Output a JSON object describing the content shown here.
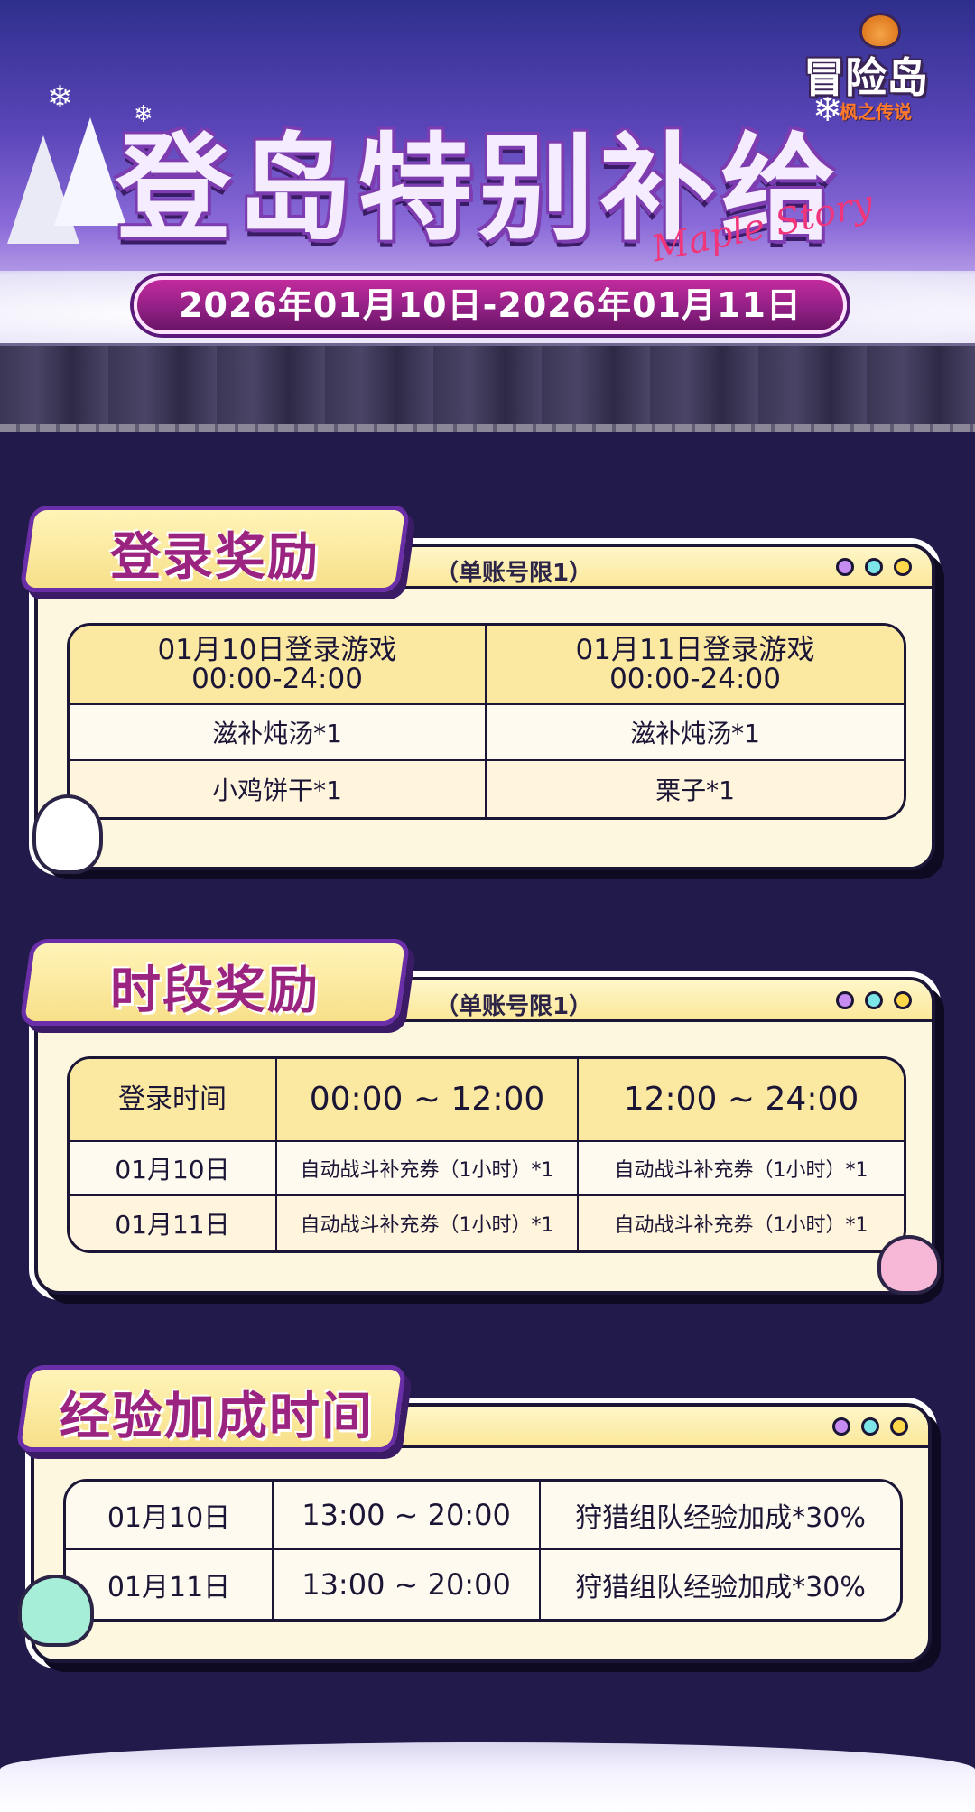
{
  "hero": {
    "title": "登岛特别补给",
    "script_text": "Maple Story",
    "date_range": "2026年01月10日-2026年01月11日",
    "logo": {
      "main": "冒险岛",
      "sub": "枫之传说"
    }
  },
  "login_reward": {
    "tab_label": "登录奖励",
    "limit_note": "（单账号限1）",
    "columns": [
      {
        "header_line1": "01月10日登录游戏",
        "header_line2": "00:00-24:00",
        "items": [
          "滋补炖汤*1",
          "小鸡饼干*1"
        ]
      },
      {
        "header_line1": "01月11日登录游戏",
        "header_line2": "00:00-24:00",
        "items": [
          "滋补炖汤*1",
          "栗子*1"
        ]
      }
    ]
  },
  "period_reward": {
    "tab_label": "时段奖励",
    "limit_note": "（单账号限1）",
    "headers": [
      "登录时间",
      "00:00 ~ 12:00",
      "12:00 ~ 24:00"
    ],
    "rows": [
      {
        "date": "01月10日",
        "morning": "自动战斗补充券（1小时）*1",
        "afternoon": "自动战斗补充券（1小时）*1"
      },
      {
        "date": "01月11日",
        "morning": "自动战斗补充券（1小时）*1",
        "afternoon": "自动战斗补充券（1小时）*1"
      }
    ]
  },
  "exp_bonus": {
    "tab_label": "经验加成时间",
    "rows": [
      {
        "date": "01月10日",
        "time": "13:00 ~ 20:00",
        "bonus": "狩猎组队经验加成*30%"
      },
      {
        "date": "01月11日",
        "time": "13:00 ~ 20:00",
        "bonus": "狩猎组队经验加成*30%"
      }
    ]
  },
  "colors": {
    "page_bg": "#221a4a",
    "panel_bg": "#fdf7e0",
    "header_cell": "#fbe9a2",
    "tab_text": "#9b2480",
    "date_banner": "#8e1f82"
  }
}
